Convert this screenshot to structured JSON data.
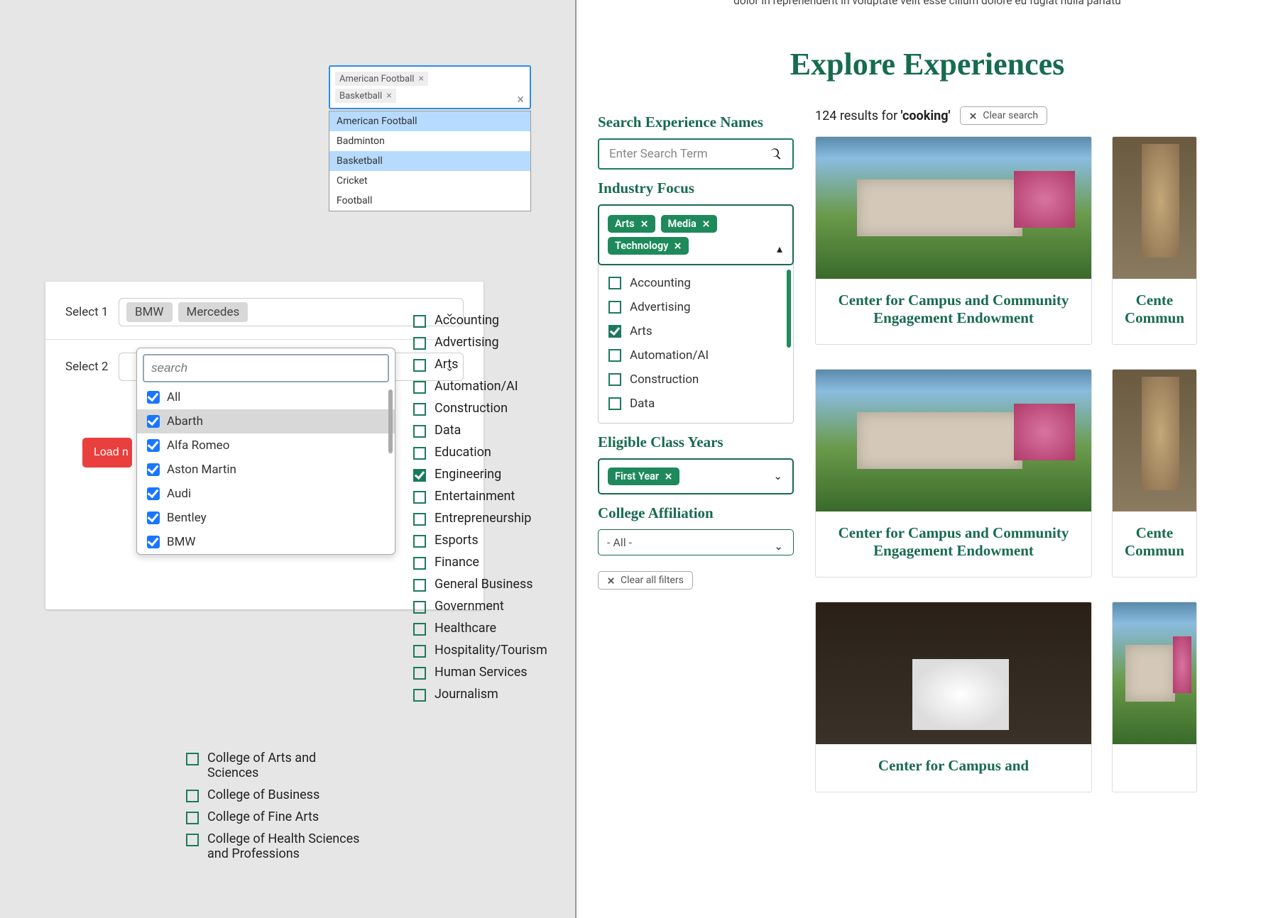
{
  "sports": {
    "chips": [
      "American Football",
      "Basketball"
    ],
    "options": [
      {
        "label": "American Football",
        "highlight": true
      },
      {
        "label": "Badminton",
        "highlight": false
      },
      {
        "label": "Basketball",
        "highlight": true
      },
      {
        "label": "Cricket",
        "highlight": false
      },
      {
        "label": "Football",
        "highlight": false
      }
    ]
  },
  "cars": {
    "select1_label": "Select 1",
    "select1_chips": [
      "BMW",
      "Mercedes"
    ],
    "select2_label": "Select 2",
    "search_placeholder": "search",
    "load_button": "Load n",
    "options": [
      {
        "label": "All",
        "checked": true,
        "highlight": false
      },
      {
        "label": "Abarth",
        "checked": true,
        "highlight": true
      },
      {
        "label": "Alfa Romeo",
        "checked": true,
        "highlight": false
      },
      {
        "label": "Aston Martin",
        "checked": true,
        "highlight": false
      },
      {
        "label": "Audi",
        "checked": true,
        "highlight": false
      },
      {
        "label": "Bentley",
        "checked": true,
        "highlight": false
      },
      {
        "label": "BMW",
        "checked": true,
        "highlight": false
      }
    ]
  },
  "industry_left": [
    {
      "label": "Accounting",
      "checked": false
    },
    {
      "label": "Advertising",
      "checked": false
    },
    {
      "label": "Arts",
      "checked": false
    },
    {
      "label": "Automation/AI",
      "checked": false
    },
    {
      "label": "Construction",
      "checked": false
    },
    {
      "label": "Data",
      "checked": false
    },
    {
      "label": "Education",
      "checked": false
    },
    {
      "label": "Engineering",
      "checked": true
    },
    {
      "label": "Entertainment",
      "checked": false
    },
    {
      "label": "Entrepreneurship",
      "checked": false
    },
    {
      "label": "Esports",
      "checked": false
    },
    {
      "label": "Finance",
      "checked": false
    },
    {
      "label": "General Business",
      "checked": false
    },
    {
      "label": "Government",
      "checked": false
    },
    {
      "label": "Healthcare",
      "checked": false
    },
    {
      "label": "Hospitality/Tourism",
      "checked": false
    },
    {
      "label": "Human Services",
      "checked": false
    },
    {
      "label": "Journalism",
      "checked": false
    }
  ],
  "colleges": [
    {
      "label": "College of Arts and Sciences"
    },
    {
      "label": "College of Business"
    },
    {
      "label": "College of Fine Arts"
    },
    {
      "label": "College of Health Sciences and Professions"
    }
  ],
  "lorem": "dolor in reprehenderit in voluptate velit esse cillum dolore eu fugiat nulla pariatu",
  "explore": {
    "title": "Explore Experiences",
    "search_heading": "Search Experience Names",
    "search_placeholder": "Enter Search Term",
    "results_count": "124",
    "results_label": "results for",
    "results_term": "'cooking'",
    "clear_search": "Clear search",
    "industry_heading": "Industry Focus",
    "tags": [
      "Arts",
      "Media",
      "Technology"
    ],
    "industry_options": [
      {
        "label": "Accounting",
        "checked": false
      },
      {
        "label": "Advertising",
        "checked": false
      },
      {
        "label": "Arts",
        "checked": true
      },
      {
        "label": "Automation/AI",
        "checked": false
      },
      {
        "label": "Construction",
        "checked": false
      },
      {
        "label": "Data",
        "checked": false
      }
    ],
    "class_years_heading": "Eligible Class Years",
    "class_years_tag": "First Year",
    "college_heading": "College Affiliation",
    "college_value": "- All -",
    "clear_all": "Clear all filters",
    "card_title": "Center for Campus and Community Engagement Endowment",
    "card_title_partial_1": "Cente",
    "card_title_partial_2": "Commun",
    "card_title_bottom": "Center for Campus and"
  }
}
